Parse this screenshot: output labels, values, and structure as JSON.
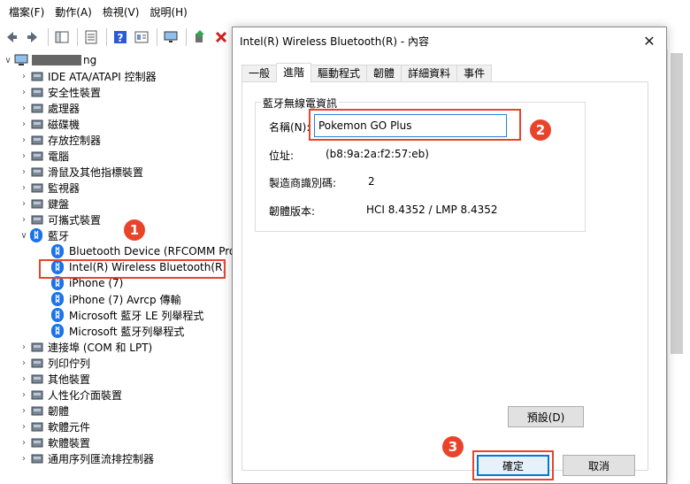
{
  "menu": [
    "檔案(F)",
    "動作(A)",
    "檢視(V)",
    "說明(H)"
  ],
  "toolbar": {
    "icons": [
      "back-arrow-icon",
      "forward-arrow-icon",
      "properties-pane-icon",
      "list-view-icon",
      "help-icon",
      "details-view-icon",
      "monitor-icon",
      "update-driver-icon",
      "uninstall-device-icon",
      "download-icon"
    ]
  },
  "tree": {
    "root_suffix": "ng",
    "items": [
      {
        "label": "IDE ATA/ATAPI 控制器",
        "icon": "ide-controller-icon"
      },
      {
        "label": "安全性裝置",
        "icon": "security-device-icon"
      },
      {
        "label": "處理器",
        "icon": "processor-icon"
      },
      {
        "label": "磁碟機",
        "icon": "disk-drive-icon"
      },
      {
        "label": "存放控制器",
        "icon": "storage-controller-icon"
      },
      {
        "label": "電腦",
        "icon": "computer-icon"
      },
      {
        "label": "滑鼠及其他指標裝置",
        "icon": "mouse-icon"
      },
      {
        "label": "監視器",
        "icon": "monitor-icon"
      },
      {
        "label": "鍵盤",
        "icon": "keyboard-icon"
      },
      {
        "label": "可攜式裝置",
        "icon": "portable-device-icon"
      },
      {
        "label": "藍牙",
        "icon": "bluetooth-icon"
      }
    ],
    "bluetooth_children": [
      "Bluetooth Device (RFCOMM Prot",
      "Intel(R) Wireless Bluetooth(R)",
      "iPhone (7)",
      "iPhone (7) Avrcp 傳輸",
      "Microsoft 藍牙 LE 列舉程式",
      "Microsoft 藍牙列舉程式"
    ],
    "after_items": [
      {
        "label": "連接埠 (COM 和 LPT)",
        "icon": "port-icon"
      },
      {
        "label": "列印佇列",
        "icon": "printer-icon"
      },
      {
        "label": "其他裝置",
        "icon": "other-device-icon"
      },
      {
        "label": "人性化介面裝置",
        "icon": "hid-icon"
      },
      {
        "label": "韌體",
        "icon": "firmware-icon"
      },
      {
        "label": "軟體元件",
        "icon": "software-component-icon"
      },
      {
        "label": "軟體裝置",
        "icon": "software-device-icon"
      },
      {
        "label": "通用序列匯流排控制器",
        "icon": "usb-controller-icon"
      }
    ]
  },
  "callouts": [
    "1",
    "2",
    "3"
  ],
  "dialog": {
    "title": "Intel(R) Wireless Bluetooth(R) - 內容",
    "tabs": [
      "一般",
      "進階",
      "驅動程式",
      "韌體",
      "詳細資料",
      "事件"
    ],
    "active_tab": "進階",
    "group_label": "藍牙無線電資訊",
    "name_label": "名稱(N):",
    "name_value": "Pokemon GO Plus",
    "address_label": "位址:",
    "address_value": "(b8:9a:2a:f2:57:eb)",
    "manufacturer_label": "製造商識別碼:",
    "manufacturer_value": "2",
    "firmware_label": "韌體版本:",
    "firmware_value": "HCI 8.4352  /  LMP 8.4352",
    "default_button": "預設(D)",
    "ok_button": "確定",
    "cancel_button": "取消"
  },
  "colors": {
    "accent": "#0078d7",
    "highlight": "#e8442b",
    "bluetooth": "#1a73e8"
  }
}
